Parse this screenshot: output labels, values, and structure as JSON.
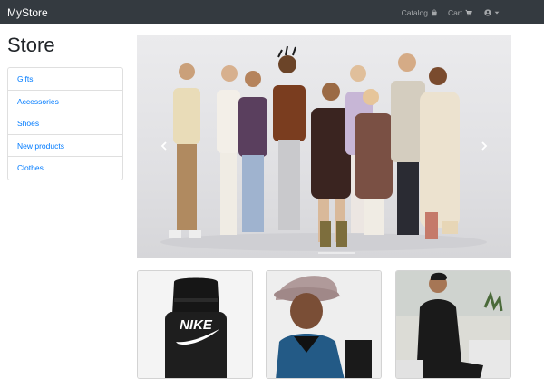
{
  "navbar": {
    "brand": "MyStore",
    "catalog_label": "Catalog",
    "cart_label": "Cart",
    "icons": [
      "shopping-bag-icon",
      "shopping-cart-icon",
      "user-circle-icon",
      "caret-down-icon"
    ]
  },
  "page": {
    "title": "Store"
  },
  "sidebar": {
    "items": [
      {
        "label": "Gifts"
      },
      {
        "label": "Accessories"
      },
      {
        "label": "Shoes"
      },
      {
        "label": "New products"
      },
      {
        "label": "Clothes"
      }
    ]
  },
  "carousel": {
    "image": "group-of-models-photo",
    "controls": [
      "carousel-prev-icon",
      "carousel-next-icon"
    ]
  },
  "products": [
    {
      "image": "black-nike-backpack-photo"
    },
    {
      "image": "bucket-hat-jacket-model-photo"
    },
    {
      "image": "black-tracksuit-model-photo"
    }
  ],
  "colors": {
    "navbar_bg": "#343a40",
    "link": "#007bff",
    "nav_text": "rgba(255,255,255,0.55)"
  }
}
